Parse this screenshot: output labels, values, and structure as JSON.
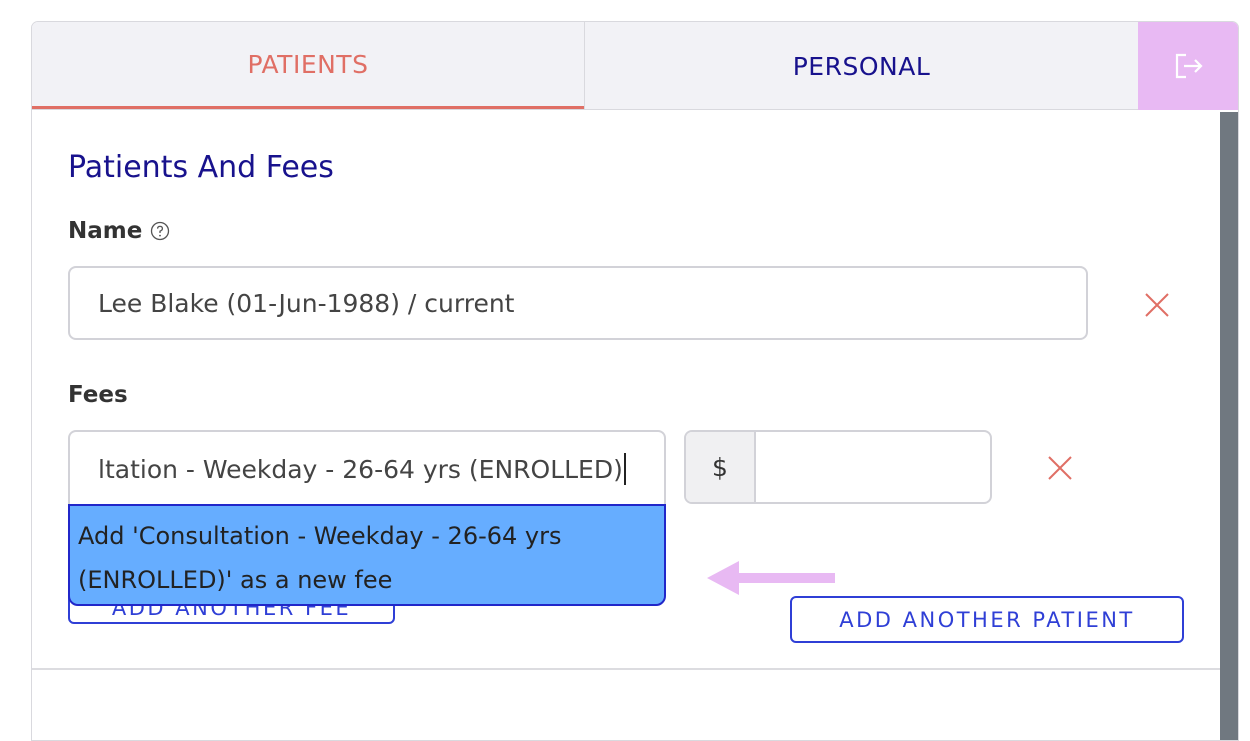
{
  "tabs": {
    "patients": "PATIENTS",
    "personal": "PERSONAL",
    "exit_icon": "exit-icon"
  },
  "section": {
    "title": "Patients And Fees"
  },
  "name_field": {
    "label": "Name",
    "help_icon": "question-circle-icon",
    "value": "Lee Blake (01-Jun-1988) / current"
  },
  "fees": {
    "label": "Fees",
    "input_value": "ltation - Weekday - 26-64 yrs (ENROLLED)",
    "currency_symbol": "$",
    "amount_value": "",
    "suggestion": "Add 'Consultation - Weekday - 26-64 yrs (ENROLLED)' as a new fee"
  },
  "buttons": {
    "add_another_fee": "ADD ANOTHER FEE",
    "add_another_patient": "ADD ANOTHER PATIENT"
  },
  "colors": {
    "accent_coral": "#e06f65",
    "navy": "#18128d",
    "button_blue": "#2f3fd6",
    "dropdown_highlight": "#66adff",
    "exit_tab": "#e8b9f3",
    "annotation_arrow": "#e8b9f3"
  }
}
